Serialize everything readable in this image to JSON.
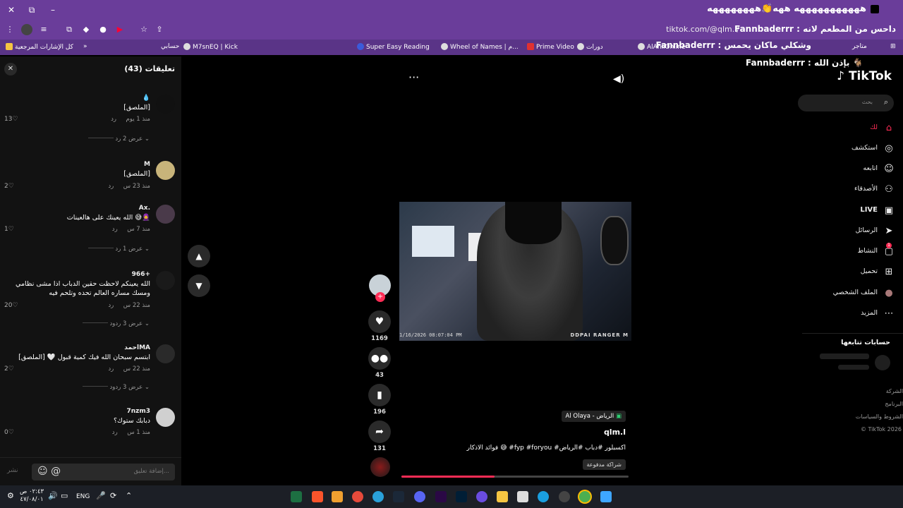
{
  "browser": {
    "window_controls": {
      "close": "✕",
      "restore": "⧉",
      "minimize": "–"
    },
    "tab_title": "هههههههههههه ههه👏ههههههههه",
    "url": "tiktok.com/@qlm.l/",
    "overlay_line1": "Fannbaderrr : داحس من المطعم لانه",
    "overlay_line2": "Fannbaderrr : وشكلي ماكان يحمس",
    "bookmarks": [
      {
        "label": "كل الإشارات المرجعية",
        "color": "#f5c542"
      },
      {
        "label": "حسابي",
        "color": "#dddddd"
      },
      {
        "label": "M7snEQ | Kick",
        "color": "#53fc18"
      },
      {
        "label": "Super Easy Reading",
        "color": "#3b5bdb"
      },
      {
        "label": "Wheel of Names | م...",
        "color": "#e64980"
      },
      {
        "label": "Prime Video",
        "color": "#e03131"
      },
      {
        "label": "دورات",
        "color": "#dddddd"
      },
      {
        "label": "AlAhliOnline",
        "color": "#dddddd"
      },
      {
        "label": "متاجر",
        "color": "#dddddd"
      }
    ]
  },
  "comments_panel": {
    "title": "تعليقات (43)",
    "close_icon": "✕",
    "input_placeholder": "إضافة تعليق...",
    "post_label": "نشر",
    "comments": [
      {
        "name": "💧",
        "text": "[الملصق]",
        "time": "منذ 1 يوم",
        "reply": "رد",
        "likes": "13",
        "replies": "عرض 2 رد",
        "avatar_color": "#111111"
      },
      {
        "name": "M",
        "text": "[الملصق]",
        "time": "منذ 23 س",
        "reply": "رد",
        "likes": "2",
        "replies": "",
        "avatar_color": "#c8b47a"
      },
      {
        "name": "Ax.",
        "text": "الله يعينك على هالعينات 😅🧕",
        "time": "منذ 7 س",
        "reply": "رد",
        "likes": "1",
        "replies": "عرض 1 رد",
        "avatar_color": "#4a3a4a"
      },
      {
        "name": "966+",
        "text": "الله يعينكم لاحظت حقين الدباب اذا مشى نظامي ومسك مساره العالم تحده وتلحم فيه",
        "time": "منذ 22 س",
        "reply": "رد",
        "likes": "20",
        "replies": "عرض 3 ردود",
        "avatar_color": "#1a1a1a"
      },
      {
        "name": "احمدMA",
        "text": "ابتسم سبحان الله فيك كمية قبول 🤍 [الملصق]",
        "time": "منذ 22 س",
        "reply": "رد",
        "likes": "2",
        "replies": "عرض 3 ردود",
        "avatar_color": "#2a2a2a"
      },
      {
        "name": "7nzm3",
        "text": "دبابك ستوك؟",
        "time": "منذ 1 س",
        "reply": "رد",
        "likes": "0",
        "replies": "",
        "avatar_color": "#d0d0d0"
      }
    ]
  },
  "video": {
    "timestamp": "1/16/2026 08:07:04 PM",
    "brand": "DDPAI RANGER M",
    "progress": 0.41
  },
  "actions": {
    "likes": "1169",
    "comments": "43",
    "saves": "196",
    "shares": "131"
  },
  "caption": {
    "location": "Al Olaya - الرياض",
    "username": "qlm.l",
    "text": "فوائد الاذكار 😅 #fyp #foryou #اكسبلور #دباب #الرياض",
    "paid_badge": "شراكة مدفوعة"
  },
  "sidebar": {
    "overlay": "Fannbaderrr : بإذن الله 🐐",
    "logo": "TikTok",
    "search_placeholder": "بحث",
    "nav": [
      {
        "label": "لك",
        "icon": "⌂",
        "active": true
      },
      {
        "label": "استكشف",
        "icon": "◎",
        "active": false
      },
      {
        "label": "اتابعه",
        "icon": "👤",
        "active": false
      },
      {
        "label": "الأصدقاء",
        "icon": "👥",
        "active": false
      },
      {
        "label": "LIVE",
        "icon": "▣",
        "active": false
      },
      {
        "label": "الرسائل",
        "icon": "➤",
        "active": false
      },
      {
        "label": "النشاط",
        "icon": "▢",
        "active": false
      },
      {
        "label": "تحميل",
        "icon": "⊞",
        "active": false
      },
      {
        "label": "الملف الشخصي",
        "icon": "●",
        "active": false
      },
      {
        "label": "المزيد",
        "icon": "⋯",
        "active": false
      }
    ],
    "notif_count": "1",
    "following_title": "حسابات تتابعها",
    "footer": [
      "الشركة",
      "البرنامج",
      "الشروط والسياسات",
      "© TikTok 2026"
    ]
  },
  "taskbar": {
    "time": "٠٢:٤٣ ص",
    "date": "٤٧/٠٨/٠١",
    "lang": "ENG",
    "apps": [
      "excel",
      "brave",
      "app-a",
      "git",
      "telegram",
      "steam",
      "discord",
      "premiere",
      "photoshop",
      "app-play",
      "folder",
      "store",
      "edge",
      "app-circle",
      "chrome",
      "windows"
    ]
  }
}
